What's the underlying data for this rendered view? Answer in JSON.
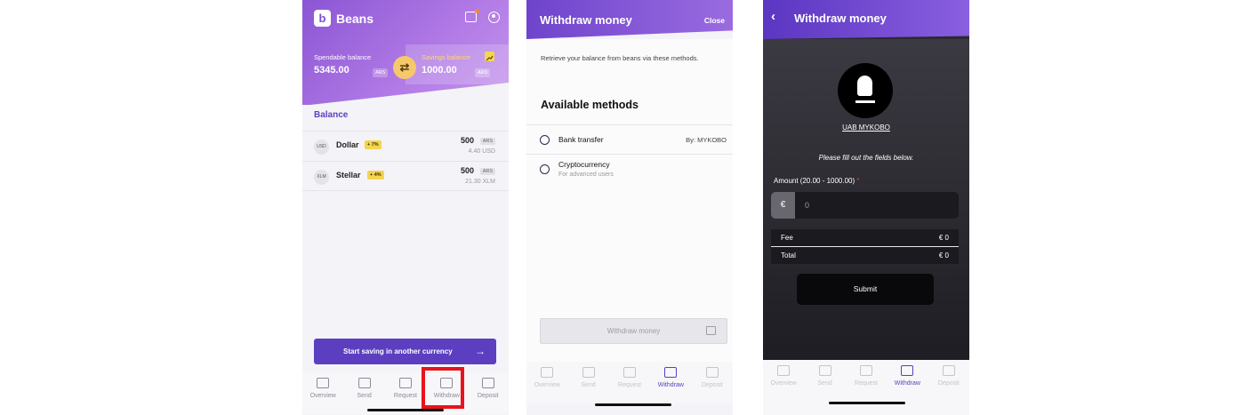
{
  "screen1": {
    "app_name": "Beans",
    "logo_letter": "b",
    "spendable": {
      "label": "Spendable balance",
      "value": "5345.00",
      "currency": "ARS"
    },
    "savings": {
      "label": "Savings balance",
      "value": "1000.00",
      "currency": "ARS"
    },
    "swap_glyph": "⇄",
    "balance_title": "Balance",
    "rows": [
      {
        "code": "USD",
        "name": "Dollar",
        "pct": "+ 7%",
        "amount": "500",
        "currency": "ARS",
        "sub": "4.40 USD"
      },
      {
        "code": "XLM",
        "name": "Stellar",
        "pct": "+ 4%",
        "amount": "500",
        "currency": "ARS",
        "sub": "21.30 XLM"
      }
    ],
    "cta_label": "Start saving in another currency",
    "cta_arrow": "→"
  },
  "screen2": {
    "title": "Withdraw money",
    "close_label": "Close",
    "intro": "Retrieve your balance from beans via these methods.",
    "available_title": "Available methods",
    "methods": [
      {
        "name": "Bank transfer",
        "provider": "By: MYKOBO"
      },
      {
        "name": "Cryptocurrency",
        "subtitle": "For advanced users"
      }
    ],
    "button_label": "Withdraw money"
  },
  "screen3": {
    "title": "Withdraw money",
    "back_glyph": "‹",
    "provider_name": "UAB MYKOBO",
    "hint": "Please fill out the fields below.",
    "amount_label": "Amount (20.00 - 1000.00)",
    "required_mark": "*",
    "currency_symbol": "€",
    "amount_value": "0",
    "fee_label": "Fee",
    "fee_value": "€ 0",
    "total_label": "Total",
    "total_value": "€ 0",
    "submit_label": "Submit"
  },
  "tabs": [
    "Overview",
    "Send",
    "Request",
    "Withdraw",
    "Deposit"
  ],
  "tab_icons": [
    "wallet-icon",
    "send-icon",
    "qr-icon",
    "withdraw-icon",
    "deposit-icon"
  ],
  "colors": {
    "brand": "#5b3fc0",
    "highlight": "#e8131c",
    "badge": "#f5d44f"
  }
}
